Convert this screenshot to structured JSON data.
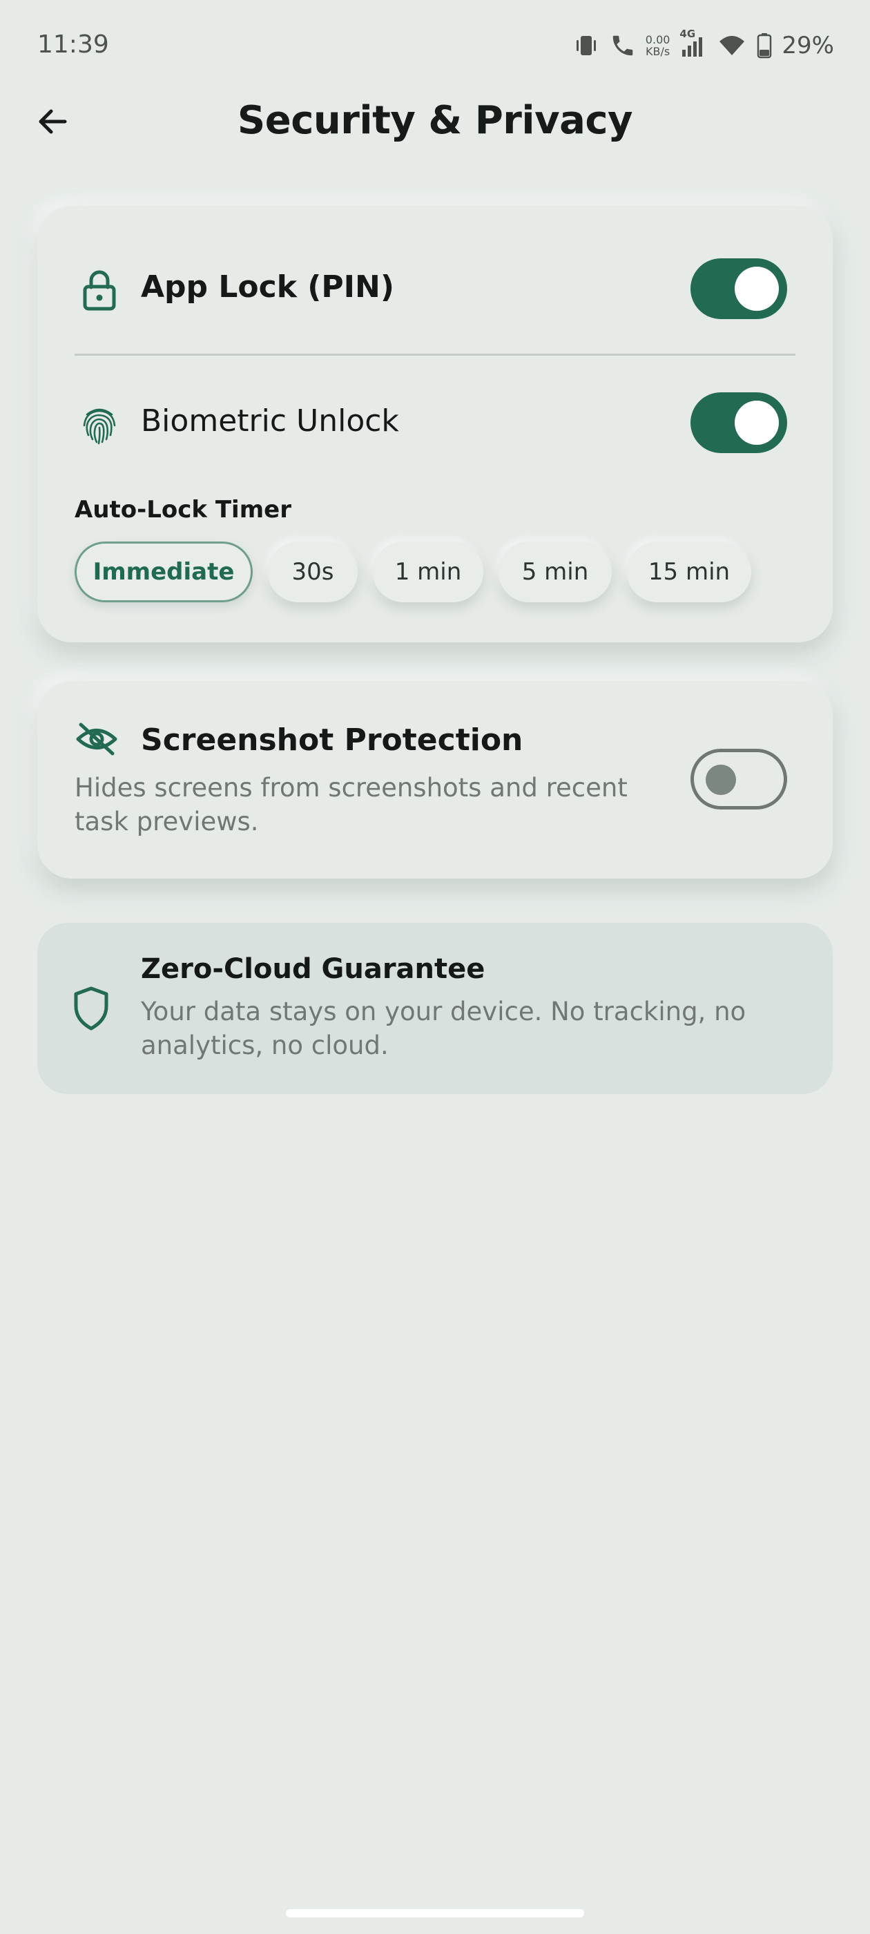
{
  "status_bar": {
    "time": "11:39",
    "net_speed_value": "0.00",
    "net_speed_unit": "KB/s",
    "network_type": "4G",
    "battery": "29%"
  },
  "header": {
    "title": "Security & Privacy"
  },
  "security_card": {
    "app_lock": {
      "label": "App Lock (PIN)",
      "enabled": true
    },
    "biometric": {
      "label": "Biometric Unlock",
      "enabled": true
    },
    "auto_lock": {
      "label": "Auto-Lock Timer",
      "options": [
        "Immediate",
        "30s",
        "1 min",
        "5 min",
        "15 min"
      ],
      "selected": "Immediate"
    }
  },
  "screenshot_card": {
    "title": "Screenshot Protection",
    "description": "Hides screens from screenshots and recent task previews.",
    "enabled": false
  },
  "guarantee_card": {
    "title": "Zero-Cloud Guarantee",
    "description": "Your data stays on your device. No tracking, no analytics, no cloud."
  },
  "colors": {
    "accent": "#226b52",
    "background": "#e6ebe8",
    "toggle_off_border": "#707873",
    "guarantee_bg": "#d9e1de"
  }
}
